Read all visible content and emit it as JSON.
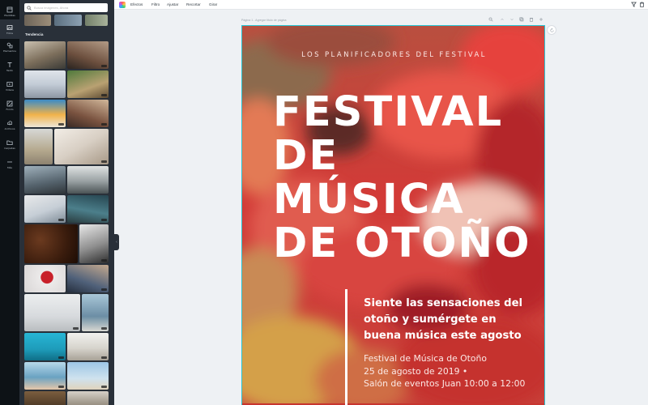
{
  "sidebar": {
    "items": [
      {
        "label": "Plantillas",
        "icon": "template-icon"
      },
      {
        "label": "Fotos",
        "icon": "photo-icon"
      },
      {
        "label": "Elementos",
        "icon": "shapes-icon"
      },
      {
        "label": "Texto",
        "icon": "text-icon"
      },
      {
        "label": "Videos",
        "icon": "video-icon"
      },
      {
        "label": "Fondo",
        "icon": "background-icon"
      },
      {
        "label": "Archivos",
        "icon": "upload-icon"
      },
      {
        "label": "Carpetas",
        "icon": "folder-icon"
      },
      {
        "label": "Más",
        "icon": "more-icon"
      }
    ]
  },
  "panel": {
    "search_placeholder": "Busca imágenes, Ahora",
    "section_title": "Tendencia"
  },
  "toolbar": {
    "menu": [
      "Efectos",
      "Filtro",
      "Ajustar",
      "Recortar",
      "Girar"
    ]
  },
  "page": {
    "caption": "Página 1 - Agregar título de página"
  },
  "poster": {
    "tagline": "LOS PLANIFICADORES DEL FESTIVAL",
    "title_lines": [
      "FESTIVAL",
      "DE",
      "MÚSICA",
      "DE OTOÑO"
    ],
    "blurb_lines": [
      "Siente las sensaciones del",
      "otoño y sumérgete en",
      "buena música este agosto"
    ],
    "details": [
      "Festival de Música de Otoño",
      "25 de agosto de 2019 •",
      "Salón de eventos Juan 10:00 a 12:00"
    ]
  },
  "colors": {
    "rail": "#0d1216",
    "panel": "#293039",
    "poster_red": "#c7352f",
    "selection": "#29c7d6"
  }
}
